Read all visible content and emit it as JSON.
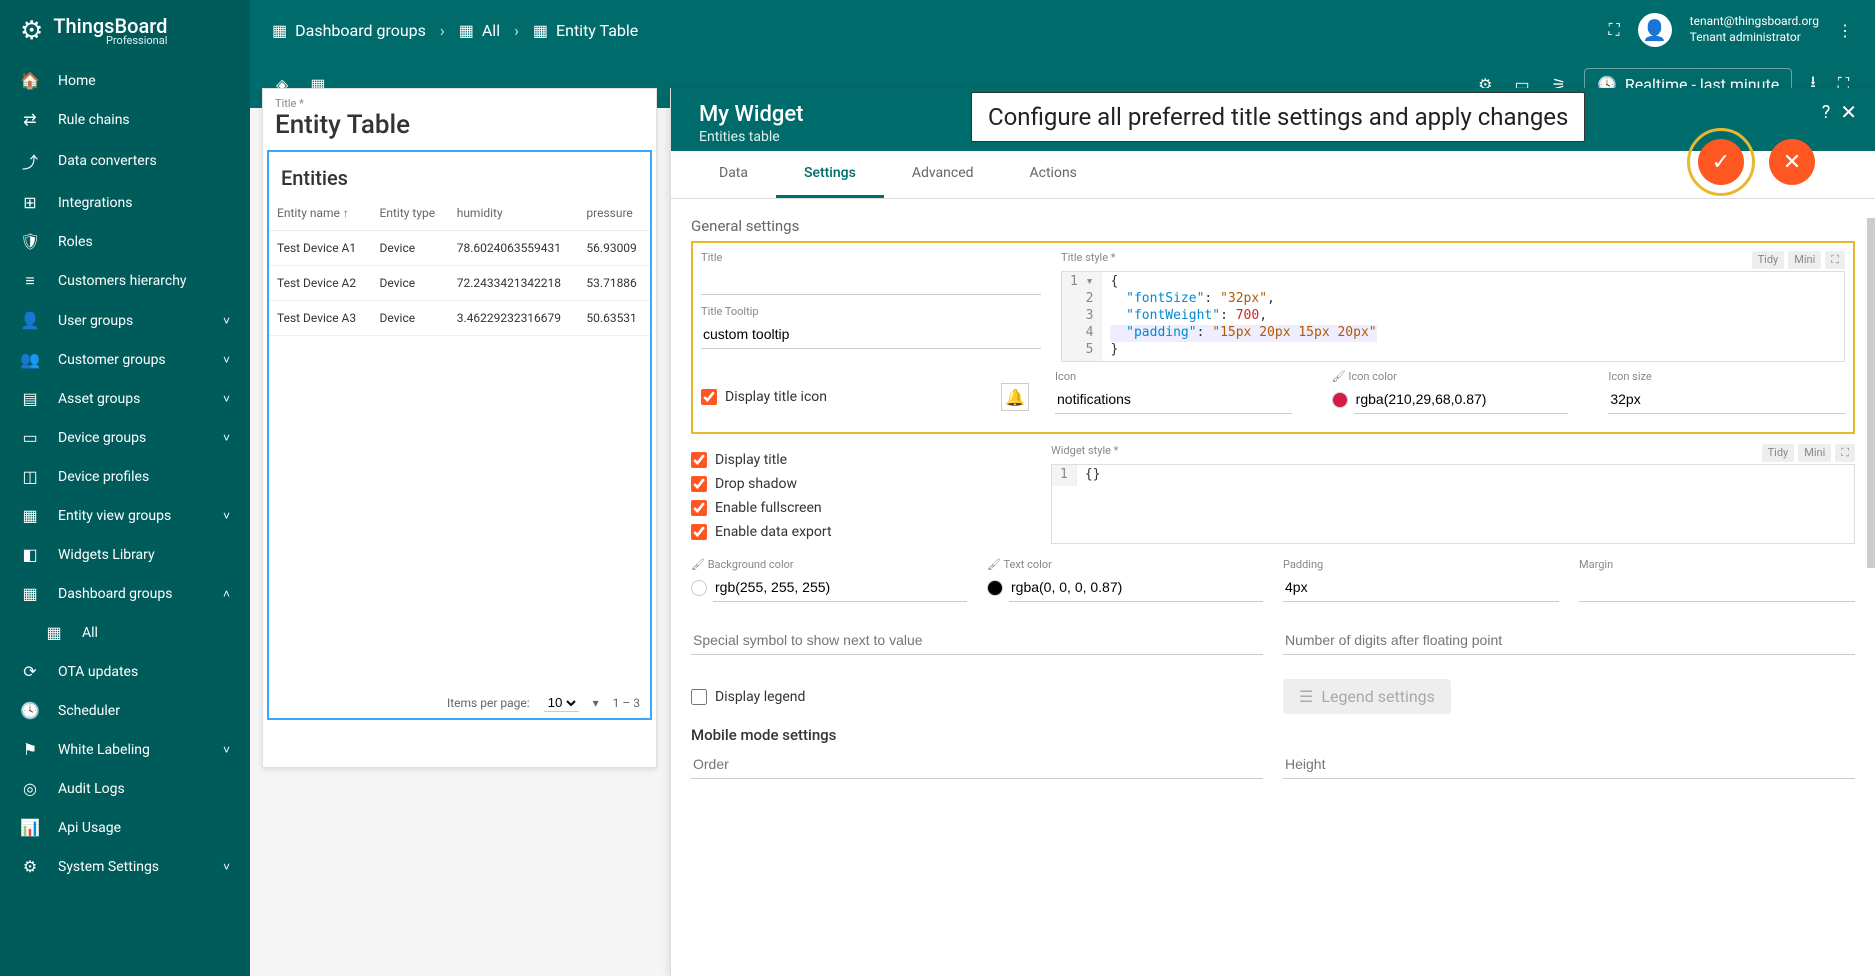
{
  "brand": {
    "name": "ThingsBoard",
    "edition": "Professional"
  },
  "breadcrumb": {
    "l1": "Dashboard groups",
    "l2": "All",
    "l3": "Entity Table"
  },
  "user": {
    "email": "tenant@thingsboard.org",
    "role": "Tenant administrator"
  },
  "timewindow": "Realtime - last minute",
  "sidebar": {
    "items": [
      {
        "icon": "home",
        "label": "Home"
      },
      {
        "icon": "rules",
        "label": "Rule chains"
      },
      {
        "icon": "conv",
        "label": "Data converters"
      },
      {
        "icon": "integ",
        "label": "Integrations"
      },
      {
        "icon": "roles",
        "label": "Roles"
      },
      {
        "icon": "hier",
        "label": "Customers hierarchy"
      },
      {
        "icon": "user",
        "label": "User groups",
        "expand": true
      },
      {
        "icon": "cust",
        "label": "Customer groups",
        "expand": true
      },
      {
        "icon": "asset",
        "label": "Asset groups",
        "expand": true
      },
      {
        "icon": "device",
        "label": "Device groups",
        "expand": true
      },
      {
        "icon": "profile",
        "label": "Device profiles"
      },
      {
        "icon": "entity",
        "label": "Entity view groups",
        "expand": true
      },
      {
        "icon": "widget",
        "label": "Widgets Library"
      },
      {
        "icon": "dash",
        "label": "Dashboard groups",
        "expand": true,
        "open": true
      },
      {
        "icon": "all",
        "label": "All",
        "child": true
      },
      {
        "icon": "ota",
        "label": "OTA updates"
      },
      {
        "icon": "sched",
        "label": "Scheduler"
      },
      {
        "icon": "white",
        "label": "White Labeling",
        "expand": true
      },
      {
        "icon": "audit",
        "label": "Audit Logs"
      },
      {
        "icon": "api",
        "label": "Api Usage"
      },
      {
        "icon": "settings",
        "label": "System Settings",
        "expand": true
      }
    ]
  },
  "entity_card": {
    "title_lbl": "Title *",
    "title": "Entity Table",
    "header": "Entities",
    "cols": [
      "Entity name",
      "Entity type",
      "humidity",
      "pressure"
    ],
    "rows": [
      {
        "name": "Test Device A1",
        "type": "Device",
        "humidity": "78.6024063559431",
        "pressure": "56.93009"
      },
      {
        "name": "Test Device A2",
        "type": "Device",
        "humidity": "72.2433421342218",
        "pressure": "53.71886"
      },
      {
        "name": "Test Device A3",
        "type": "Device",
        "humidity": "3.46229232316679",
        "pressure": "50.63531"
      }
    ],
    "pager": {
      "lbl": "Items per page:",
      "size": "10",
      "range": "1 – 3"
    }
  },
  "panel": {
    "title": "My Widget",
    "subtitle": "Entities table",
    "callout": "Configure all preferred title settings and apply changes",
    "tabs": [
      "Data",
      "Settings",
      "Advanced",
      "Actions"
    ],
    "section": "General settings",
    "mobile_section": "Mobile mode settings",
    "title_field": {
      "lbl": "Title",
      "value": ""
    },
    "tooltip_field": {
      "lbl": "Title Tooltip",
      "value": "custom tooltip"
    },
    "title_style": {
      "lbl": "Title style *",
      "btns": {
        "tidy": "Tidy",
        "mini": "Mini"
      },
      "lines": [
        "{",
        "  \"fontSize\": \"32px\",",
        "  \"fontWeight\": 700,",
        "  \"padding\": \"15px 20px 15px 20px\"",
        "}"
      ]
    },
    "display_icon": {
      "lbl": "Display title icon",
      "checked": true
    },
    "icon": {
      "lbl": "Icon",
      "value": "notifications"
    },
    "icon_color": {
      "lbl": "Icon color",
      "value": "rgba(210,29,68,0.87)",
      "swatch": "#d21d44"
    },
    "icon_size": {
      "lbl": "Icon size",
      "value": "32px"
    },
    "display_title": {
      "lbl": "Display title",
      "checked": true
    },
    "drop_shadow": {
      "lbl": "Drop shadow",
      "checked": true
    },
    "enable_fullscreen": {
      "lbl": "Enable fullscreen",
      "checked": true
    },
    "enable_export": {
      "lbl": "Enable data export",
      "checked": true
    },
    "widget_style": {
      "lbl": "Widget style *"
    },
    "bg_color": {
      "lbl": "Background color",
      "value": "rgb(255, 255, 255)",
      "swatch": "#ffffff"
    },
    "text_color": {
      "lbl": "Text color",
      "value": "rgba(0, 0, 0, 0.87)",
      "swatch": "#000000"
    },
    "padding": {
      "lbl": "Padding",
      "value": "4px"
    },
    "margin": {
      "lbl": "Margin",
      "value": ""
    },
    "special": {
      "lbl": "Special symbol to show next to value"
    },
    "digits": {
      "lbl": "Number of digits after floating point"
    },
    "legend": {
      "lbl": "Display legend",
      "checked": false,
      "btn": "Legend settings"
    },
    "order": {
      "lbl": "Order"
    },
    "height": {
      "lbl": "Height"
    }
  }
}
